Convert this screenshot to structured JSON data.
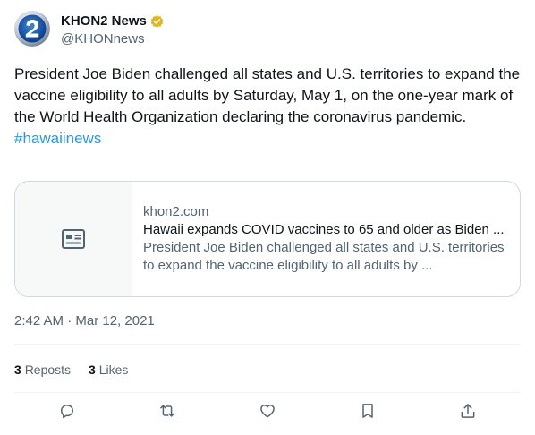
{
  "author": {
    "display_name": "KHON2 News",
    "handle": "@KHONnews",
    "avatar_icon": "khon2-logo-icon",
    "verified_color": "#e2b719"
  },
  "tweet": {
    "text": "President Joe Biden challenged all states and U.S. territories to expand the vaccine eligibility to all adults by Saturday, May 1, on the one-year mark of the World Health Organization declaring the coronavirus pandemic.",
    "hashtag": "#hawaiinews",
    "timestamp": "2:42 AM · Mar 12, 2021"
  },
  "card": {
    "thumb_icon": "article-icon",
    "domain": "khon2.com",
    "title": "Hawaii expands COVID vaccines to 65 and older as Biden ...",
    "description": "President Joe Biden challenged all states and U.S. territories to expand the vaccine eligibility to all adults by ..."
  },
  "stats": {
    "reposts_count": "3",
    "reposts_label": "Reposts",
    "likes_count": "3",
    "likes_label": "Likes"
  },
  "actions": [
    "reply-icon",
    "repost-icon",
    "like-icon",
    "bookmark-icon",
    "share-icon"
  ],
  "colors": {
    "link": "#1d9bf0",
    "secondary_text": "#536471",
    "primary_text": "#0f1419",
    "border": "#cfd9de"
  }
}
